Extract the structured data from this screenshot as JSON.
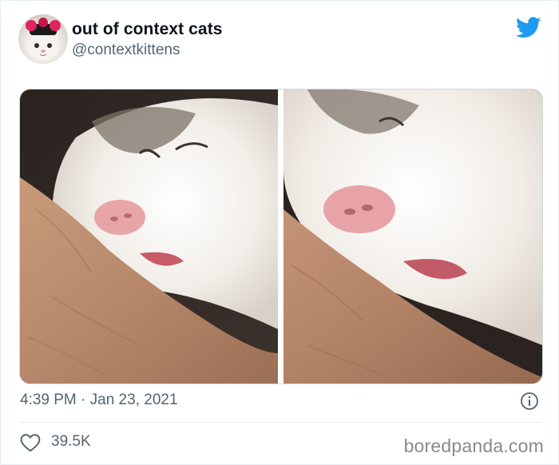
{
  "tweet": {
    "display_name": "out of context cats",
    "handle": "@contextkittens",
    "timestamp": "4:39 PM · Jan 23, 2021",
    "like_count": "39.5K"
  },
  "media": {
    "photo_count": 2
  },
  "icons": {
    "brand": "twitter-bird-icon",
    "info": "info-icon",
    "like": "heart-icon"
  },
  "colors": {
    "twitter_blue": "#1d9bf0",
    "secondary_text": "#536471",
    "divider": "#e6ecf0"
  },
  "watermark": "boredpanda.com"
}
